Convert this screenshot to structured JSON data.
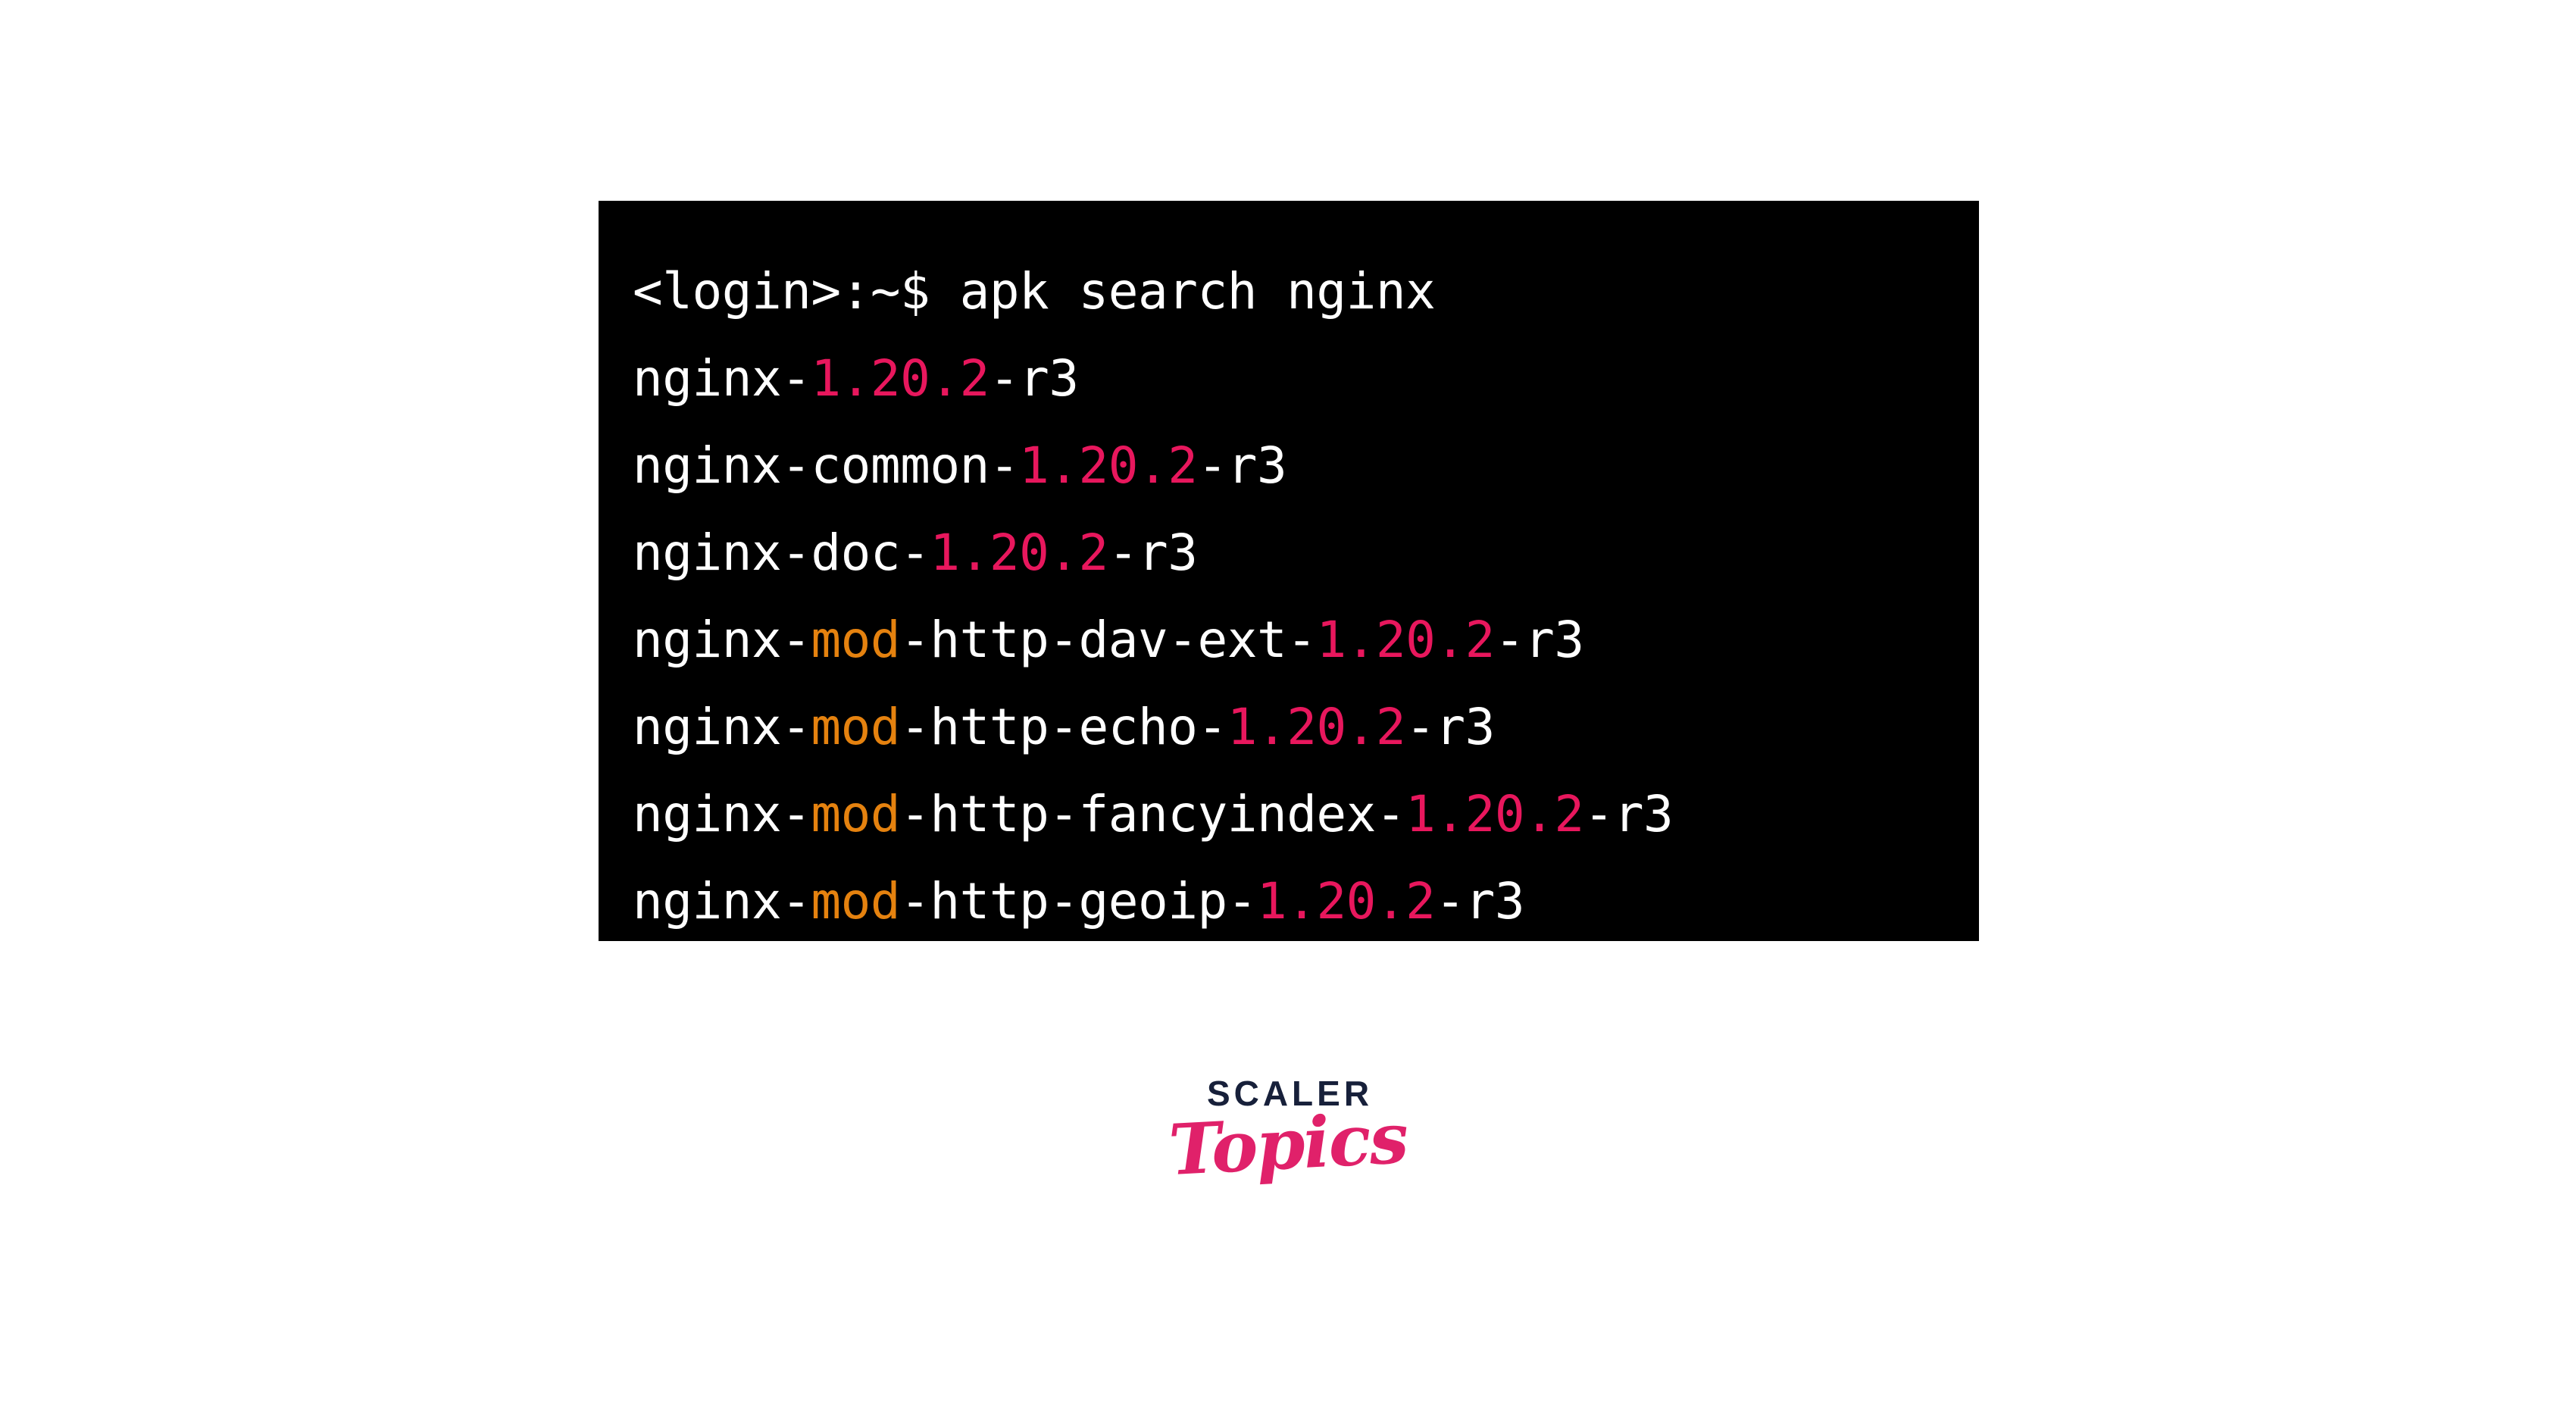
{
  "terminal": {
    "background_color": "#000000",
    "prompt_color": "#ffffff",
    "version_color": "#e8175d",
    "module_color": "#e5820f",
    "command": {
      "prompt": "<login>:~$ ",
      "text": "apk search nginx"
    },
    "lines": [
      {
        "id": "prompt-line",
        "segments": [
          {
            "text": "<login>:~$ apk search nginx",
            "color": "white"
          }
        ]
      },
      {
        "id": "result-nginx",
        "segments": [
          {
            "text": "nginx-",
            "color": "white"
          },
          {
            "text": "1.20.2",
            "color": "pink"
          },
          {
            "text": "-r3",
            "color": "white"
          }
        ]
      },
      {
        "id": "result-nginx-common",
        "segments": [
          {
            "text": "nginx-common-",
            "color": "white"
          },
          {
            "text": "1.20.2",
            "color": "pink"
          },
          {
            "text": "-r3",
            "color": "white"
          }
        ]
      },
      {
        "id": "result-nginx-doc",
        "segments": [
          {
            "text": "nginx-doc-",
            "color": "white"
          },
          {
            "text": "1.20.2",
            "color": "pink"
          },
          {
            "text": "-r3",
            "color": "white"
          }
        ]
      },
      {
        "id": "result-nginx-mod-http-dav-ext",
        "segments": [
          {
            "text": "nginx-",
            "color": "white"
          },
          {
            "text": "mod",
            "color": "orange"
          },
          {
            "text": "-http-dav-ext-",
            "color": "white"
          },
          {
            "text": "1.20.2",
            "color": "pink"
          },
          {
            "text": "-r3",
            "color": "white"
          }
        ]
      },
      {
        "id": "result-nginx-mod-http-echo",
        "segments": [
          {
            "text": "nginx-",
            "color": "white"
          },
          {
            "text": "mod",
            "color": "orange"
          },
          {
            "text": "-http-echo-",
            "color": "white"
          },
          {
            "text": "1.20.2",
            "color": "pink"
          },
          {
            "text": "-r3",
            "color": "white"
          }
        ]
      },
      {
        "id": "result-nginx-mod-http-fancyindex",
        "segments": [
          {
            "text": "nginx-",
            "color": "white"
          },
          {
            "text": "mod",
            "color": "orange"
          },
          {
            "text": "-http-fancyindex-",
            "color": "white"
          },
          {
            "text": "1.20.2",
            "color": "pink"
          },
          {
            "text": "-r3",
            "color": "white"
          }
        ]
      },
      {
        "id": "result-nginx-mod-http-geoip",
        "segments": [
          {
            "text": "nginx-",
            "color": "white"
          },
          {
            "text": "mod",
            "color": "orange"
          },
          {
            "text": "-http-geoip-",
            "color": "white"
          },
          {
            "text": "1.20.2",
            "color": "pink"
          },
          {
            "text": "-r3",
            "color": "white"
          }
        ]
      }
    ],
    "plain_lines": [
      "<login>:~$ apk search nginx",
      "nginx-1.20.2-r3",
      "nginx-common-1.20.2-r3",
      "nginx-doc-1.20.2-r3",
      "nginx-mod-http-dav-ext-1.20.2-r3",
      "nginx-mod-http-echo-1.20.2-r3",
      "nginx-mod-http-fancyindex-1.20.2-r3",
      "nginx-mod-http-geoip-1.20.2-r3"
    ]
  },
  "logo": {
    "wordmark": "SCALER",
    "script": "Topics",
    "wordmark_color": "#17203a",
    "script_color": "#e0216a"
  }
}
